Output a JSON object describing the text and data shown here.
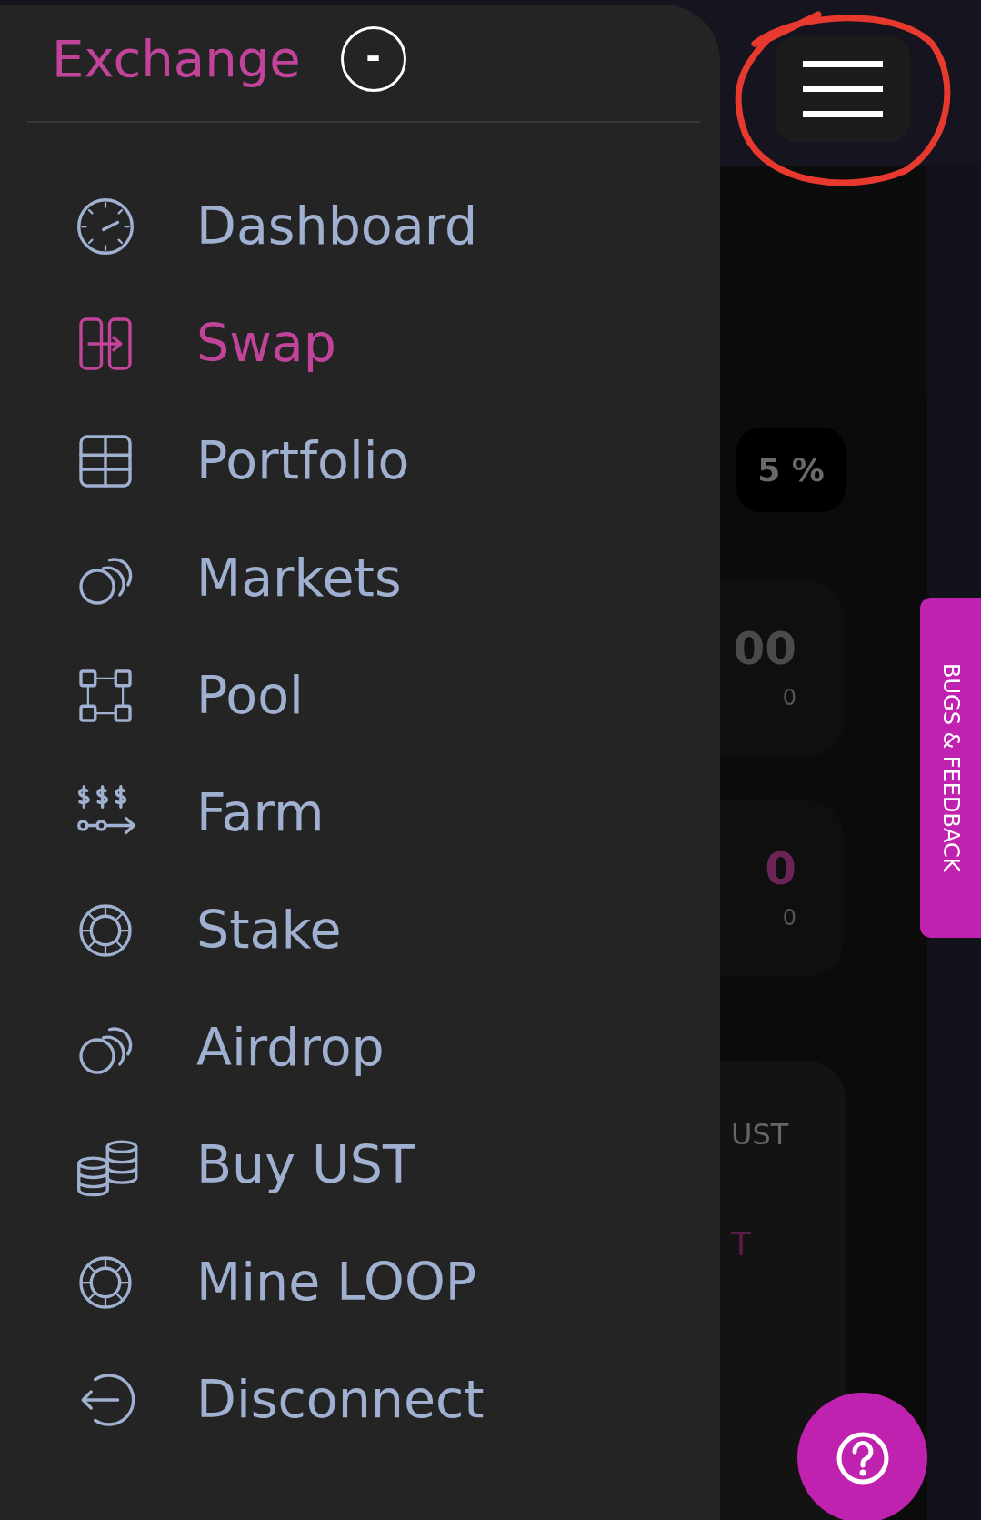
{
  "header": {
    "title": "Exchange",
    "collapse_label": "-"
  },
  "menu": [
    {
      "label": "Dashboard",
      "kind": "gauge",
      "selected": false
    },
    {
      "label": "Swap",
      "kind": "swap",
      "selected": true
    },
    {
      "label": "Portfolio",
      "kind": "grid",
      "selected": false
    },
    {
      "label": "Markets",
      "kind": "coins",
      "selected": false
    },
    {
      "label": "Pool",
      "kind": "nodes",
      "selected": false
    },
    {
      "label": "Farm",
      "kind": "farm",
      "selected": false
    },
    {
      "label": "Stake",
      "kind": "ring",
      "selected": false
    },
    {
      "label": "Airdrop",
      "kind": "coins",
      "selected": false
    },
    {
      "label": "Buy UST",
      "kind": "stack",
      "selected": false
    },
    {
      "label": "Mine LOOP",
      "kind": "ring",
      "selected": false
    },
    {
      "label": "Disconnect",
      "kind": "exit",
      "selected": false
    }
  ],
  "menu_button": {
    "highlighted": true
  },
  "background": {
    "fee": "5 %",
    "cards": [
      {
        "value": "00",
        "sub": "0",
        "accent": false
      },
      {
        "value": "0",
        "sub": "0",
        "accent": true
      }
    ],
    "balance": {
      "line_1": "UST",
      "line_2": "T"
    }
  },
  "feedback_tab": "BUGS & FEEDBACK"
}
